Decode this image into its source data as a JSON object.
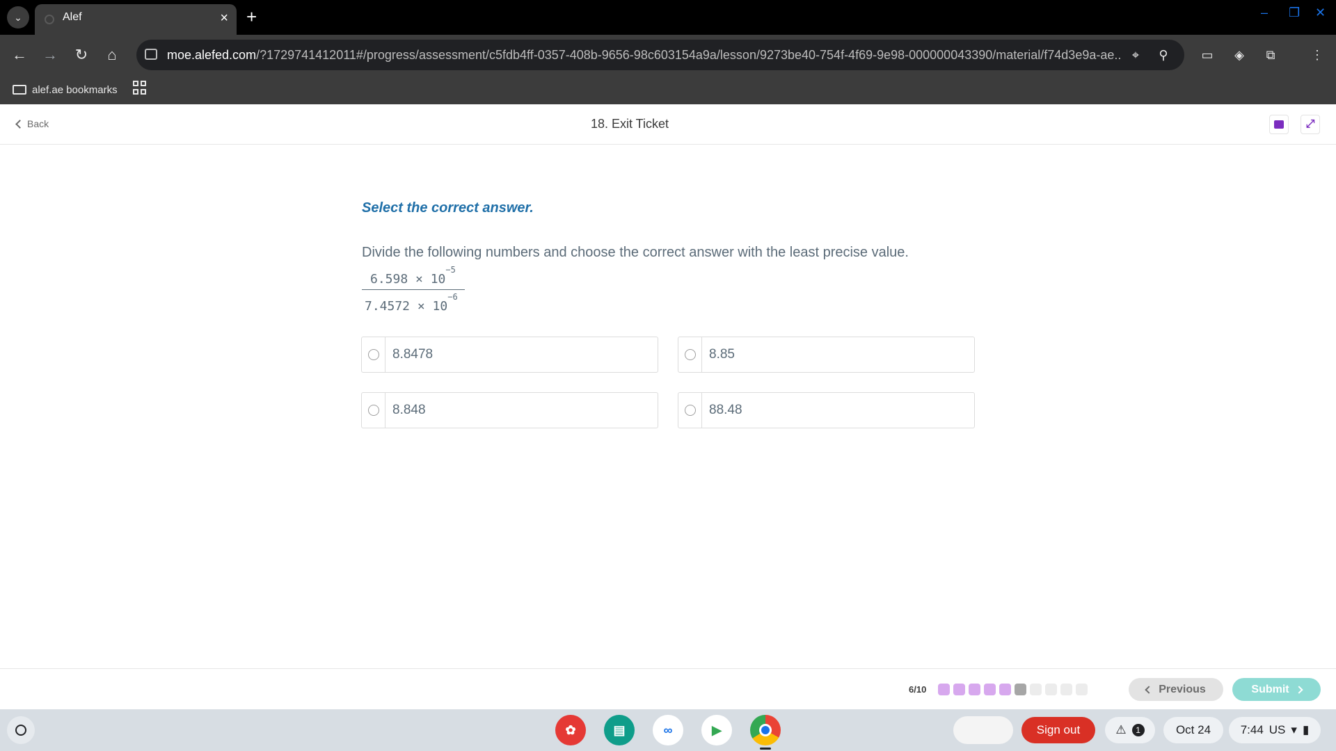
{
  "browser": {
    "tab_title": "Alef",
    "url_host": "moe.alefed.com",
    "url_rest": "/?1729741412011#/progress/assessment/c5fdb4ff-0357-408b-9656-98c603154a9a/lesson/9273be40-754f-4f69-9e98-000000043390/material/f74d3e9a-ae...",
    "bookmark_folder": "alef.ae bookmarks"
  },
  "header": {
    "back_label": "Back",
    "title": "18. Exit Ticket"
  },
  "question": {
    "instruction": "Select the correct answer.",
    "prompt": "Divide the following numbers and choose the correct answer with the least precise value.",
    "numerator_base": "6.598 × 10",
    "numerator_exp": "−5",
    "denominator_base": "7.4572 × 10",
    "denominator_exp": "−6",
    "options": [
      "8.8478",
      "8.85",
      "8.848",
      "88.48"
    ]
  },
  "footer": {
    "progress_label": "6/10",
    "progress_current": 6,
    "progress_total": 10,
    "previous_label": "Previous",
    "submit_label": "Submit"
  },
  "shelf": {
    "sign_out_label": "Sign out",
    "notification_count": "1",
    "date": "Oct 24",
    "time": "7:44",
    "locale": "US"
  },
  "colors": {
    "accent_purple": "#7b2cbf",
    "instruction_blue": "#1f6fa8",
    "progress_done": "#d7a8ee",
    "progress_current": "#a6a6a6",
    "progress_todo": "#ececec",
    "submit_bg": "#8edbd4",
    "sign_out_bg": "#d93025"
  }
}
